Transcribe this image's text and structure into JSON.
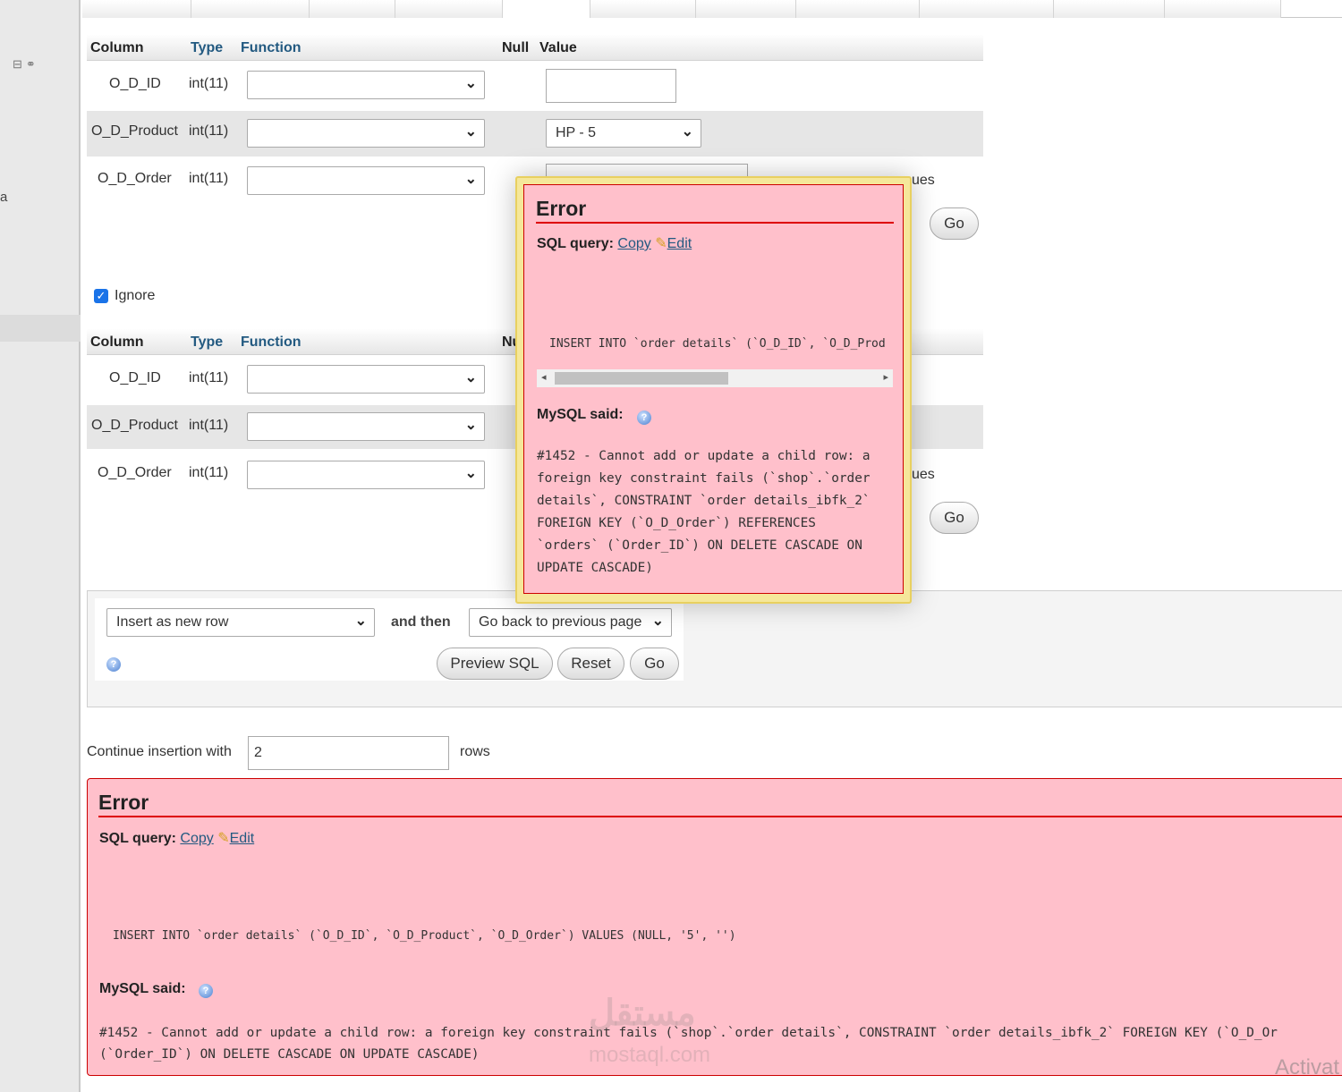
{
  "left_nav": {
    "letter": "a",
    "icons": [
      "collapse-icon",
      "link-icon"
    ]
  },
  "form1": {
    "headers": {
      "column": "Column",
      "type": "Type",
      "function": "Function",
      "null": "Null",
      "value": "Value"
    },
    "rows": [
      {
        "column": "O_D_ID",
        "type": "int(11)",
        "function": "",
        "value": ""
      },
      {
        "column": "O_D_Product",
        "type": "int(11)",
        "function": "",
        "value": "HP - 5"
      },
      {
        "column": "O_D_Order",
        "type": "int(11)",
        "function": "",
        "value": ""
      }
    ],
    "partial_text_1": "ues",
    "go_label": "Go"
  },
  "ignore": {
    "label": "Ignore",
    "checked": true
  },
  "form2": {
    "headers": {
      "column": "Column",
      "type": "Type",
      "function": "Function",
      "null": "Nu"
    },
    "rows": [
      {
        "column": "O_D_ID",
        "type": "int(11)",
        "function": ""
      },
      {
        "column": "O_D_Product",
        "type": "int(11)",
        "function": ""
      },
      {
        "column": "O_D_Order",
        "type": "int(11)",
        "function": ""
      }
    ],
    "partial_text_1": "ues",
    "go_label": "Go"
  },
  "actions": {
    "insert_mode": "Insert as new row",
    "and_then": "and then",
    "after_insert": "Go back to previous page",
    "preview_sql": "Preview SQL",
    "reset": "Reset",
    "go": "Go"
  },
  "continue": {
    "label": "Continue insertion with",
    "value": "2",
    "suffix": "rows"
  },
  "popup_error": {
    "title": "Error",
    "sql_query_label": "SQL query:",
    "copy": "Copy",
    "edit": "Edit",
    "query": "INSERT INTO `order details` (`O_D_ID`, `O_D_Prod",
    "mysql_said": "MySQL said:",
    "message_lines": [
      "#1452 - Cannot add or update a child row: a",
      "foreign key constraint fails (`shop`.`order",
      "details`, CONSTRAINT `order details_ibfk_2`",
      "FOREIGN KEY (`O_D_Order`) REFERENCES",
      "`orders` (`Order_ID`) ON DELETE CASCADE ON",
      "UPDATE CASCADE)"
    ]
  },
  "page_error": {
    "title": "Error",
    "sql_query_label": "SQL query:",
    "copy": "Copy",
    "edit": "Edit",
    "query": "INSERT INTO `order details` (`O_D_ID`, `O_D_Product`, `O_D_Order`) VALUES (NULL, '5', '')",
    "mysql_said": "MySQL said:",
    "message_line1": "#1452 - Cannot add or update a child row: a foreign key constraint fails (`shop`.`order details`, CONSTRAINT `order details_ibfk_2` FOREIGN KEY (`O_D_Or",
    "message_line2": "(`Order_ID`) ON DELETE CASCADE ON UPDATE CASCADE)"
  },
  "watermark": {
    "arabic": "مستقل",
    "domain": "mostaql.com"
  },
  "os_overlay": "Activat",
  "colors": {
    "error_bg": "#ffc0cb",
    "error_rule": "#dd0000",
    "link": "#235a81",
    "popup_border": "#e8d060"
  }
}
